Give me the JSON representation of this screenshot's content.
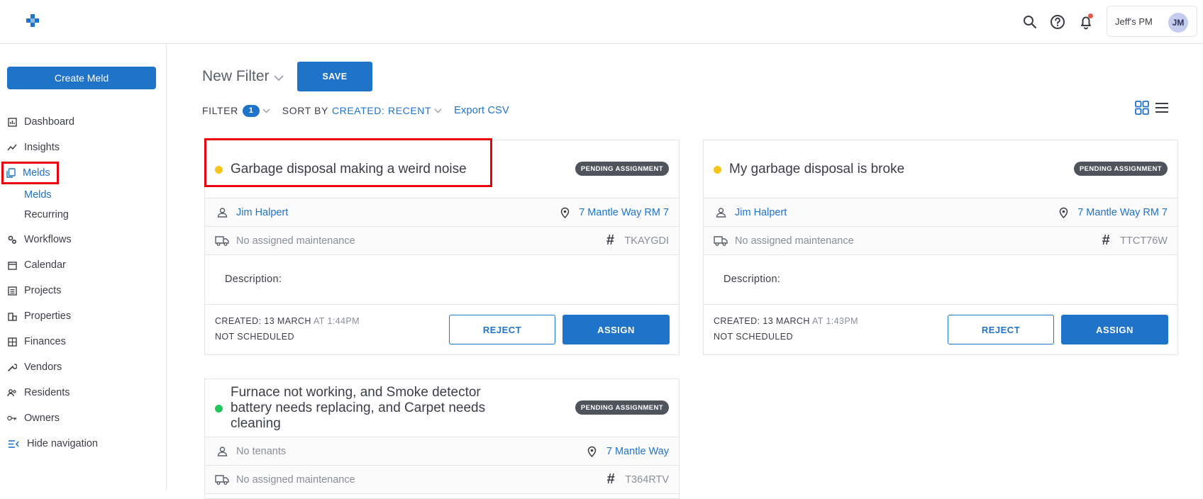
{
  "header": {
    "account_name": "Jeff's PM",
    "avatar_initials": "JM"
  },
  "sidebar": {
    "create_label": "Create Meld",
    "items": [
      {
        "label": "Dashboard",
        "icon": "dashboard-icon"
      },
      {
        "label": "Insights",
        "icon": "insights-icon"
      },
      {
        "label": "Melds",
        "icon": "melds-icon"
      },
      {
        "label": "Workflows",
        "icon": "workflows-icon"
      },
      {
        "label": "Calendar",
        "icon": "calendar-icon"
      },
      {
        "label": "Projects",
        "icon": "projects-icon"
      },
      {
        "label": "Properties",
        "icon": "properties-icon"
      },
      {
        "label": "Finances",
        "icon": "finances-icon"
      },
      {
        "label": "Vendors",
        "icon": "vendors-icon"
      },
      {
        "label": "Residents",
        "icon": "residents-icon"
      },
      {
        "label": "Owners",
        "icon": "owners-icon"
      },
      {
        "label": "Hide navigation",
        "icon": "hide-navigation-icon"
      }
    ],
    "sub_items": [
      {
        "label": "Melds"
      },
      {
        "label": "Recurring"
      }
    ]
  },
  "main": {
    "filter_name": "New Filter",
    "save_label": "SAVE",
    "filter_label": "FILTER",
    "filter_count": "1",
    "sort_label": "SORT BY",
    "sort_value": "CREATED: RECENT",
    "export_label": "Export CSV",
    "colors": {
      "accent": "#1f73c9",
      "pending": "#f5c518",
      "active": "#22c55e"
    }
  },
  "cards": [
    {
      "title": "Garbage disposal making a weird noise",
      "status": "PENDING ASSIGNMENT",
      "tenant": "Jim Halpert",
      "address": "7 Mantle Way RM 7",
      "maintenance": "No assigned maintenance",
      "ref": "TKAYGDI",
      "description_label": "Description:",
      "created_prefix": "CREATED: 13 MARCH",
      "created_time": "AT 1:44PM",
      "schedule": "NOT SCHEDULED",
      "reject_label": "REJECT",
      "assign_label": "ASSIGN"
    },
    {
      "title": "My garbage disposal is broke",
      "status": "PENDING ASSIGNMENT",
      "tenant": "Jim Halpert",
      "address": "7 Mantle Way RM 7",
      "maintenance": "No assigned maintenance",
      "ref": "TTCT76W",
      "description_label": "Description:",
      "created_prefix": "CREATED: 13 MARCH",
      "created_time": "AT 1:43PM",
      "schedule": "NOT SCHEDULED",
      "reject_label": "REJECT",
      "assign_label": "ASSIGN"
    },
    {
      "title_lines": [
        "Furnace not working, and Smoke detector",
        "battery needs replacing, and Carpet needs",
        "cleaning"
      ],
      "status": "PENDING ASSIGNMENT",
      "tenant": "No tenants",
      "address": "7 Mantle Way",
      "maintenance": "No assigned maintenance",
      "ref": "T364RTV"
    }
  ]
}
